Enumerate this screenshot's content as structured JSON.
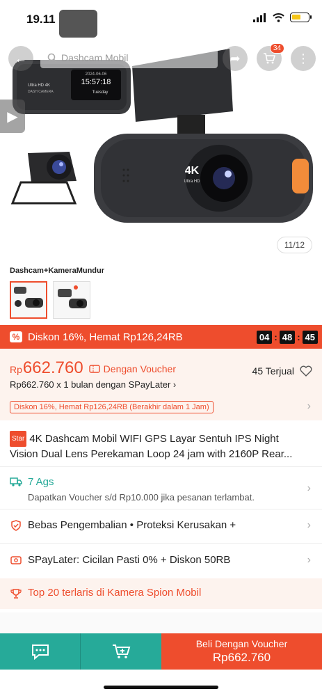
{
  "status": {
    "time": "19.11"
  },
  "topbar": {
    "search_placeholder": "Dashcam Mobil",
    "cart_count": "34"
  },
  "hero": {
    "image_counter": "11/12",
    "camera_screen_date": "2024-06-06",
    "camera_screen_time": "15:57:18",
    "camera_screen_day": "Tuesday",
    "camera_label_1": "Ultra HD 4K",
    "camera_label_2": "DASH CAMERA",
    "lens_label_1": "4K",
    "lens_label_2": "Ultra HD"
  },
  "variant": {
    "label": "Dashcam+KameraMundur"
  },
  "flash": {
    "text": "Diskon 16%, Hemat Rp126,24RB",
    "timer": [
      "04",
      "48",
      "45"
    ]
  },
  "price": {
    "currency": "Rp",
    "amount": "662.760",
    "voucher_text": "Dengan Voucher",
    "sold": "45 Terjual",
    "spaylater_line": "Rp662.760 x 1 bulan dengan SPayLater",
    "promo_pill": "Diskon 16%, Hemat Rp126,24RB (Berakhir dalam 1 Jam)"
  },
  "product": {
    "badge": "Star",
    "title_line1": "4K Dashcam Mobil WIFI GPS Layar Sentuh IPS Night",
    "title_line2": "Vision Dual Lens Perekaman Loop 24 jam with 2160P Rear..."
  },
  "shipping": {
    "days": "7 Ags",
    "sub": "Dapatkan Voucher s/d Rp10.000 jika pesanan terlambat."
  },
  "returns": {
    "text": "Bebas Pengembalian  •  Proteksi Kerusakan +"
  },
  "spaylater": {
    "text": "SPayLater: Cicilan Pasti 0% + Diskon 50RB"
  },
  "top_seller": {
    "text": "Top 20 terlaris di Kamera Spion Mobil"
  },
  "bottom": {
    "buy_label": "Beli Dengan Voucher",
    "buy_price": "Rp662.760"
  },
  "colors": {
    "brand": "#ee4d2d",
    "teal": "#26aa99",
    "price_bg": "#fdf3ee"
  }
}
